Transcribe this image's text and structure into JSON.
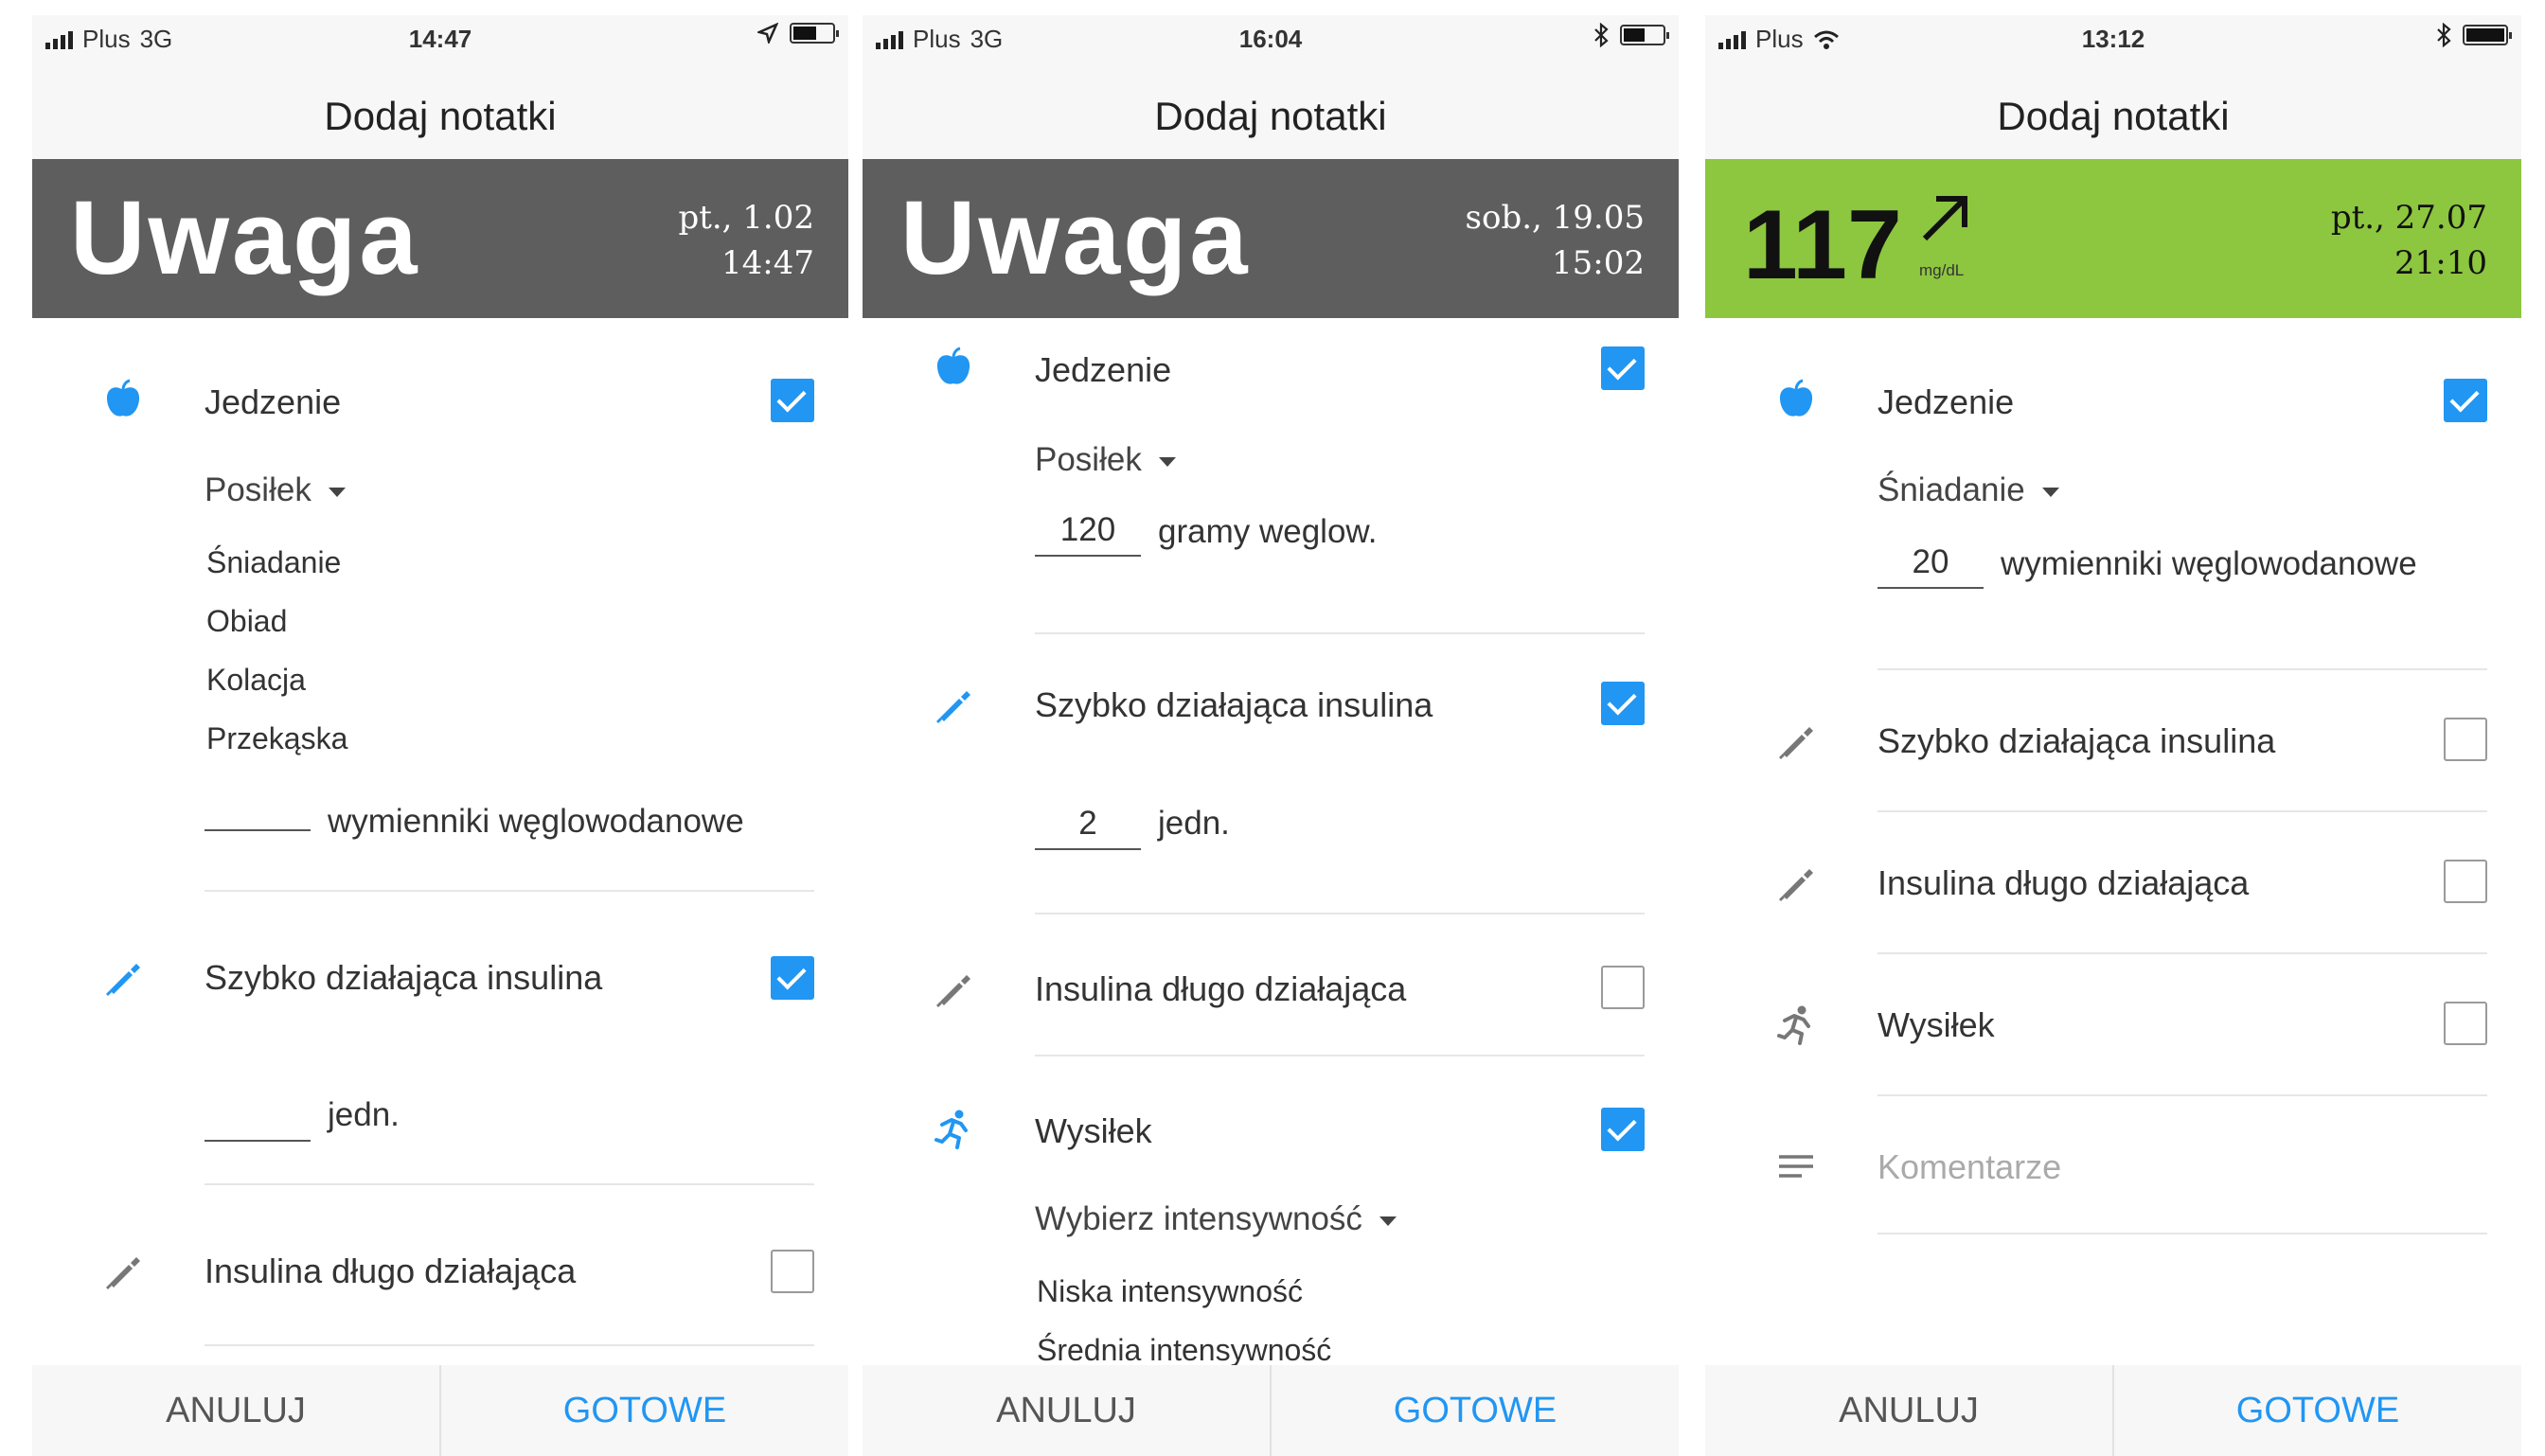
{
  "colors": {
    "accent": "#2196f3",
    "banner_warning": "#5e5e5e",
    "banner_ok": "#8dc63f"
  },
  "screens": [
    {
      "status": {
        "carrier": "Plus",
        "network": "3G",
        "time": "14:47"
      },
      "title": "Dodaj notatki",
      "banner": {
        "text": "Uwaga",
        "date": "pt., 1.02",
        "time": "14:47"
      },
      "food": {
        "label": "Jedzenie",
        "dropdown": "Posiłek",
        "options": [
          "Śniadanie",
          "Obiad",
          "Kolacja",
          "Przekąska"
        ],
        "carb_value": "",
        "carb_unit": "wymienniki węglowodanowe"
      },
      "rapid": {
        "label": "Szybko działająca insulina",
        "value": "",
        "unit": "jedn."
      },
      "long": {
        "label": "Insulina długo działająca"
      },
      "footer": {
        "cancel": "ANULUJ",
        "done": "GOTOWE"
      }
    },
    {
      "status": {
        "carrier": "Plus",
        "network": "3G",
        "time": "16:04"
      },
      "title": "Dodaj notatki",
      "banner": {
        "text": "Uwaga",
        "date": "sob., 19.05",
        "time": "15:02"
      },
      "food": {
        "label": "Jedzenie",
        "dropdown": "Posiłek",
        "carb_value": "120",
        "carb_unit": "gramy weglow."
      },
      "rapid": {
        "label": "Szybko działająca insulina",
        "value": "2",
        "unit": "jedn."
      },
      "long": {
        "label": "Insulina długo działająca"
      },
      "exercise": {
        "label": "Wysiłek",
        "dropdown": "Wybierz intensywność",
        "options": [
          "Niska intensywność",
          "Średnia intensywność"
        ]
      },
      "footer": {
        "cancel": "ANULUJ",
        "done": "GOTOWE"
      }
    },
    {
      "status": {
        "carrier": "Plus",
        "time": "13:12"
      },
      "title": "Dodaj notatki",
      "banner": {
        "glucose": "117",
        "unit": "mg/dL",
        "date": "pt., 27.07",
        "time": "21:10"
      },
      "food": {
        "label": "Jedzenie",
        "dropdown": "Śniadanie",
        "carb_value": "20",
        "carb_unit": "wymienniki węglowodanowe"
      },
      "rapid": {
        "label": "Szybko działająca insulina"
      },
      "long": {
        "label": "Insulina długo działająca"
      },
      "exercise": {
        "label": "Wysiłek"
      },
      "comment": {
        "placeholder": "Komentarze"
      },
      "footer": {
        "cancel": "ANULUJ",
        "done": "GOTOWE"
      }
    }
  ]
}
